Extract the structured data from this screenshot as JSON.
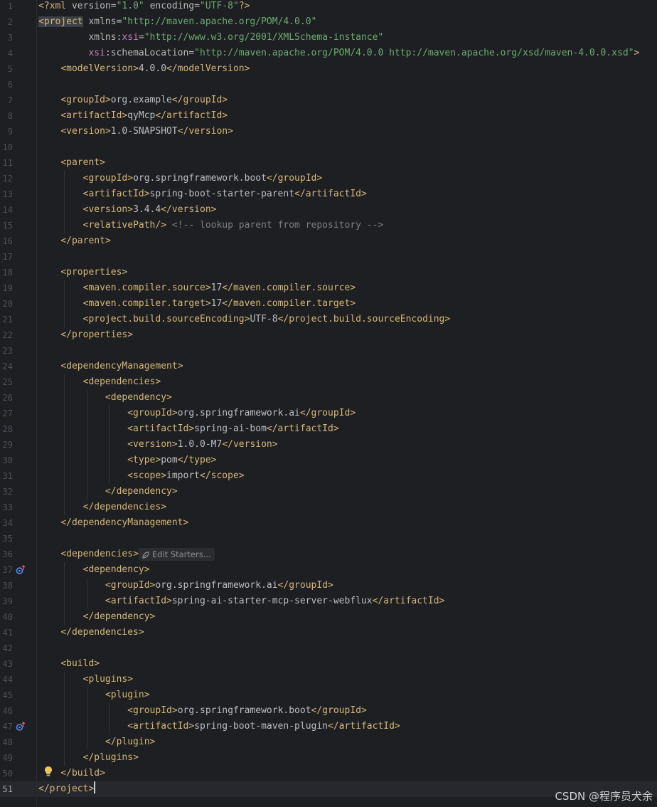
{
  "editor": {
    "language": "xml",
    "current_line": 51,
    "inlay_hint": "Edit Starters...",
    "gutter_icons": [
      {
        "line": 37,
        "icon": "maven-override-icon"
      },
      {
        "line": 47,
        "icon": "maven-override-icon"
      }
    ],
    "intention_bulb_line": 50,
    "lines": [
      "<?xml version=\"1.0\" encoding=\"UTF-8\"?>",
      "<project xmlns=\"http://maven.apache.org/POM/4.0.0\"",
      "         xmlns:xsi=\"http://www.w3.org/2001/XMLSchema-instance\"",
      "         xsi:schemaLocation=\"http://maven.apache.org/POM/4.0.0 http://maven.apache.org/xsd/maven-4.0.0.xsd\">",
      "    <modelVersion>4.0.0</modelVersion>",
      "",
      "    <groupId>org.example</groupId>",
      "    <artifactId>qyMcp</artifactId>",
      "    <version>1.0-SNAPSHOT</version>",
      "",
      "    <parent>",
      "        <groupId>org.springframework.boot</groupId>",
      "        <artifactId>spring-boot-starter-parent</artifactId>",
      "        <version>3.4.4</version>",
      "        <relativePath/> <!-- lookup parent from repository -->",
      "    </parent>",
      "",
      "    <properties>",
      "        <maven.compiler.source>17</maven.compiler.source>",
      "        <maven.compiler.target>17</maven.compiler.target>",
      "        <project.build.sourceEncoding>UTF-8</project.build.sourceEncoding>",
      "    </properties>",
      "",
      "    <dependencyManagement>",
      "        <dependencies>",
      "            <dependency>",
      "                <groupId>org.springframework.ai</groupId>",
      "                <artifactId>spring-ai-bom</artifactId>",
      "                <version>1.0.0-M7</version>",
      "                <type>pom</type>",
      "                <scope>import</scope>",
      "            </dependency>",
      "        </dependencies>",
      "    </dependencyManagement>",
      "",
      "    <dependencies>",
      "        <dependency>",
      "            <groupId>org.springframework.ai</groupId>",
      "            <artifactId>spring-ai-starter-mcp-server-webflux</artifactId>",
      "        </dependency>",
      "    </dependencies>",
      "",
      "    <build>",
      "        <plugins>",
      "            <plugin>",
      "                <groupId>org.springframework.boot</groupId>",
      "                <artifactId>spring-boot-maven-plugin</artifactId>",
      "            </plugin>",
      "        </plugins>",
      "    </build>",
      "</project>"
    ]
  },
  "watermark": {
    "text": "CSDN @程序员犬余"
  },
  "colors": {
    "background": "#1e1f22",
    "tag": "#d5b778",
    "string": "#6aab73",
    "namespace": "#c77dbb",
    "comment": "#7a7e85",
    "text": "#bcbec4",
    "line_number": "#4b5059"
  }
}
